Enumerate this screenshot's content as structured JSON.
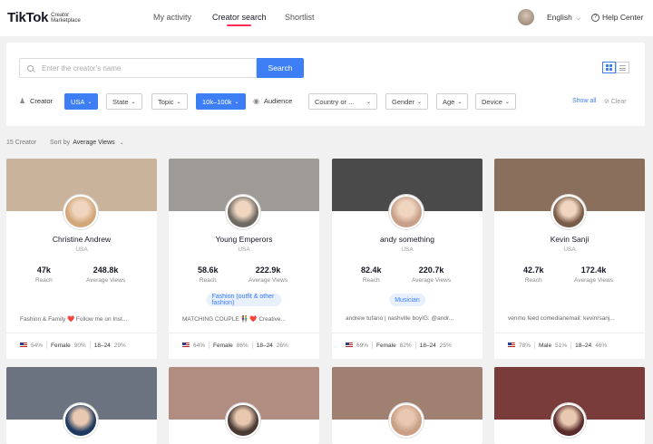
{
  "nav": {
    "logo": "TikTok",
    "logo_sub": "Creator Marketplace",
    "links": [
      "My activity",
      "Creator search",
      "Shortlist"
    ],
    "language": "English",
    "help": "Help Center"
  },
  "search": {
    "placeholder": "Enter the creator's name",
    "button": "Search"
  },
  "filters": {
    "creator_label": "Creator",
    "country": "USA",
    "state": "State",
    "topic": "Topic",
    "followers": "10k–100k",
    "audience_label": "Audience",
    "audience_country": "Country or ...",
    "gender": "Gender",
    "age": "Age",
    "device": "Device",
    "show_all": "Show all",
    "clear": "Clear"
  },
  "results": {
    "count": "15 Creator",
    "sort_label": "Sort by",
    "sort_value": "Average Views"
  },
  "labels": {
    "reach": "Reach",
    "avg_views": "Average Views"
  },
  "cards": [
    {
      "name": "Christine Andrew",
      "country": "USA",
      "reach": "47k",
      "avg_views": "248.8k",
      "tag": "",
      "bio": "Fashion & Family ❤️ Follow me on Inst...",
      "country_pct": "54%",
      "gender": "Female",
      "gender_pct": "90%",
      "age": "18–24",
      "age_pct": "29%",
      "cover_color": "#c9b39b",
      "avatar_color": "#d2a679"
    },
    {
      "name": "Young Emperors",
      "country": "USA",
      "reach": "58.6k",
      "avg_views": "222.9k",
      "tag": "Fashion (outfit & other fashion)",
      "bio": "MATCHING COUPLE 👫 ❤️ Creative...",
      "country_pct": "64%",
      "gender": "Female",
      "gender_pct": "86%",
      "age": "18–24",
      "age_pct": "26%",
      "cover_color": "#9e9b97",
      "avatar_color": "#6f6a63"
    },
    {
      "name": "andy something",
      "country": "USA",
      "reach": "82.4k",
      "avg_views": "220.7k",
      "tag": "Musician",
      "bio": "andrew tufano | nashville boyIG: @andr...",
      "country_pct": "69%",
      "gender": "Female",
      "gender_pct": "82%",
      "age": "18–24",
      "age_pct": "25%",
      "cover_color": "#4a4a4a",
      "avatar_color": "#c8a08a"
    },
    {
      "name": "Kevin Sanji",
      "country": "USA",
      "reach": "42.7k",
      "avg_views": "172.4k",
      "tag": "",
      "bio": "venmo feed comedianemail: kevinrsanj...",
      "country_pct": "78%",
      "gender": "Male",
      "gender_pct": "51%",
      "age": "18–24",
      "age_pct": "46%",
      "cover_color": "#8a6f5c",
      "avatar_color": "#7a5a48"
    }
  ],
  "row2": [
    {
      "cover_color": "#6b7280",
      "avatar_color": "#1f3a5f"
    },
    {
      "cover_color": "#b08d80",
      "avatar_color": "#4a3a33"
    },
    {
      "cover_color": "#a08070",
      "avatar_color": "#c99f86"
    },
    {
      "cover_color": "#7a3b3b",
      "avatar_color": "#5a2b2b"
    }
  ]
}
